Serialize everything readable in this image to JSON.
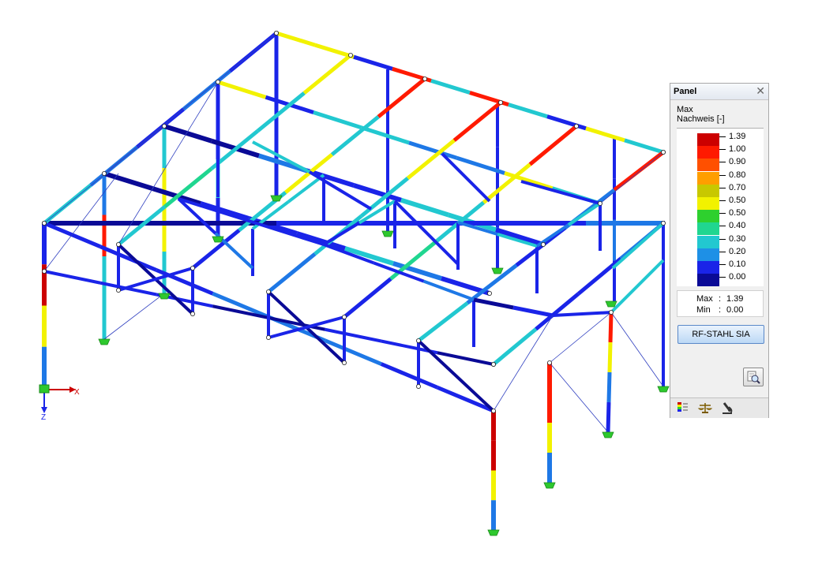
{
  "colors": {
    "s0": "#0a0a96",
    "s1": "#1a24e8",
    "s2": "#1e78e6",
    "s3": "#22c8d0",
    "s4": "#20d690",
    "s5": "#2ed02e",
    "s6": "#f2f200",
    "s7": "#c8c800",
    "s8": "#ff9e00",
    "s9": "#ff1a00",
    "s10": "#cc0000",
    "support": "#2ec82e"
  },
  "axes": {
    "x_label": "X",
    "z_label": "Z"
  },
  "panel": {
    "title": "Panel",
    "header_line1": "Max",
    "header_line2": "Nachweis [-]",
    "legend": [
      {
        "value": "1.39",
        "color": "#cc0000"
      },
      {
        "value": "1.00",
        "color": "#ff1a00"
      },
      {
        "value": "0.90",
        "color": "#ff5000"
      },
      {
        "value": "0.80",
        "color": "#ff9e00"
      },
      {
        "value": "0.70",
        "color": "#c8c800"
      },
      {
        "value": "0.50",
        "color": "#f2f200"
      },
      {
        "value": "0.50",
        "color": "#2ed02e"
      },
      {
        "value": "0.40",
        "color": "#20d690"
      },
      {
        "value": "0.30",
        "color": "#22c8d0"
      },
      {
        "value": "0.20",
        "color": "#1e90e6"
      },
      {
        "value": "0.10",
        "color": "#1a24e8"
      },
      {
        "value": "0.00",
        "color": "#0a0a96"
      }
    ],
    "max_label": "Max",
    "max_value": "1.39",
    "min_label": "Min",
    "min_value": "0.00",
    "button_label": "RF-STAHL SIA",
    "tabs": [
      "color-scale-icon",
      "balance-icon",
      "microscope-icon"
    ]
  }
}
